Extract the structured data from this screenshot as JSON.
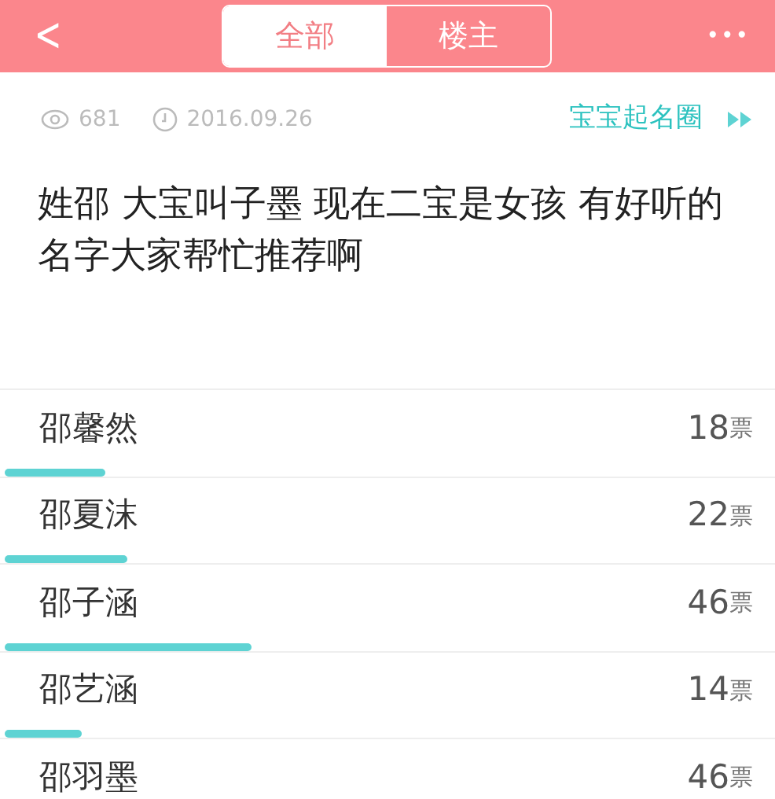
{
  "header": {
    "back": "<",
    "tabs": [
      {
        "label": "全部",
        "selected": true
      },
      {
        "label": "楼主",
        "selected": false
      }
    ],
    "more": "•••"
  },
  "meta": {
    "views": "681",
    "date": "2016.09.26",
    "circle": "宝宝起名圈"
  },
  "post": {
    "title": "姓邵 大宝叫子墨 现在二宝是女孩 有好听的名字大家帮忙推荐啊"
  },
  "poll": [
    {
      "name": "邵馨然",
      "votes": "18",
      "unit": "票",
      "level": 0.13
    },
    {
      "name": "邵夏沫",
      "votes": "22",
      "unit": "票",
      "level": 0.16
    },
    {
      "name": "邵子涵",
      "votes": "46",
      "unit": "票",
      "level": 0.32
    },
    {
      "name": "邵艺涵",
      "votes": "14",
      "unit": "票",
      "level": 0.1
    },
    {
      "name": "邵羽墨",
      "votes": "46",
      "unit": "票"
    }
  ]
}
